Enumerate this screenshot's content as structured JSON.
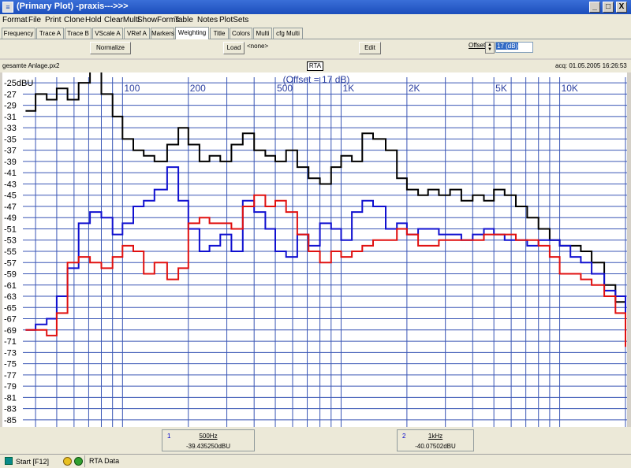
{
  "window": {
    "title": "(Primary Plot) -praxis--->>>",
    "minimize": "_",
    "maximize": "□",
    "close": "X"
  },
  "menu": [
    "Format",
    "File",
    "Print",
    "Clone",
    "Hold",
    "ClearMulti",
    "ShowForms",
    "Table",
    "Notes",
    "PlotSets"
  ],
  "tabs": [
    "Frequency",
    "Trace A",
    "Trace B",
    "VScale A",
    "VRef A",
    "Markers",
    "Weighting",
    "Title",
    "Colors",
    "Multi",
    "cfg Multi"
  ],
  "active_tab": "Weighting",
  "toolbar": {
    "normalize_label": "Normalize",
    "load_label": "Load",
    "none_label": "<none>",
    "edit_label": "Edit",
    "offset_label": "Offset",
    "offset_value": "17 (dB)"
  },
  "info": {
    "file": "gesamte Anlage.px2",
    "mode": "RTA",
    "acq": "acq: 01.05.2005 16:26:53"
  },
  "markers": [
    {
      "num": "1",
      "freq": "500Hz",
      "value": "-39.435250dBU"
    },
    {
      "num": "2",
      "freq": "1kHz",
      "value": "-40.07502dBU"
    }
  ],
  "status": {
    "start": "Start [F12]",
    "mode": "RTA Data"
  },
  "colors": {
    "grid": "#3a56b5",
    "trace_black": "#000000",
    "trace_blue": "#1010d0",
    "trace_red": "#e01010",
    "axis_text": "#2b3fa0"
  },
  "chart_data": {
    "type": "line",
    "title": "",
    "annotation": "(Offset = 17 dB)",
    "xscale": "log",
    "xlim": [
      35,
      20000
    ],
    "ylim": [
      -86,
      -24
    ],
    "x_tick_labels": [
      {
        "f": 100,
        "label": "100"
      },
      {
        "f": 200,
        "label": "200"
      },
      {
        "f": 500,
        "label": "500"
      },
      {
        "f": 1000,
        "label": "1K"
      },
      {
        "f": 2000,
        "label": "2K"
      },
      {
        "f": 5000,
        "label": "5K"
      },
      {
        "f": 10000,
        "label": "10K"
      }
    ],
    "y_tick_labels": [
      "-25dBU",
      "-27",
      "-29",
      "-31",
      "-33",
      "-35",
      "-37",
      "-39",
      "-41",
      "-43",
      "-45",
      "-47",
      "-49",
      "-51",
      "-53",
      "-55",
      "-57",
      "-59",
      "-61",
      "-63",
      "-65",
      "-67",
      "-69",
      "-71",
      "-73",
      "-75",
      "-77",
      "-79",
      "-81",
      "-83",
      "-85"
    ],
    "series": [
      {
        "color": "#000000",
        "x": [
          36,
          40,
          45,
          50,
          56,
          63,
          71,
          80,
          90,
          100,
          112,
          125,
          140,
          160,
          180,
          200,
          225,
          250,
          280,
          315,
          355,
          400,
          450,
          500,
          560,
          630,
          710,
          800,
          900,
          1000,
          1120,
          1250,
          1400,
          1600,
          1800,
          2000,
          2250,
          2500,
          2800,
          3150,
          3550,
          4000,
          4500,
          5000,
          5600,
          6300,
          7100,
          8000,
          9000,
          10000,
          11200,
          12500,
          14000,
          16000,
          18000,
          20000
        ],
        "y": [
          -30,
          -27,
          -28,
          -26,
          -28,
          -25,
          -23,
          -27,
          -31,
          -35,
          -37,
          -38,
          -39,
          -36,
          -33,
          -36,
          -39,
          -38,
          -39,
          -36,
          -34,
          -37,
          -38,
          -39,
          -37,
          -40,
          -42,
          -43,
          -40,
          -38,
          -39,
          -34,
          -35,
          -37,
          -42,
          -44,
          -45,
          -44,
          -45,
          -44,
          -46,
          -45,
          -46,
          -44,
          -45,
          -47,
          -49,
          -51,
          -53,
          -54,
          -54,
          -55,
          -57,
          -61,
          -64,
          -66
        ]
      },
      {
        "color": "#1010d0",
        "x": [
          36,
          40,
          45,
          50,
          56,
          63,
          71,
          80,
          90,
          100,
          112,
          125,
          140,
          160,
          180,
          200,
          225,
          250,
          280,
          315,
          355,
          400,
          450,
          500,
          560,
          630,
          710,
          800,
          900,
          1000,
          1120,
          1250,
          1400,
          1600,
          1800,
          2000,
          2250,
          2500,
          2800,
          3150,
          3550,
          4000,
          4500,
          5000,
          5600,
          6300,
          7100,
          8000,
          9000,
          10000,
          11200,
          12500,
          14000,
          16000,
          18000,
          20000
        ],
        "y": [
          -69,
          -68,
          -67,
          -63,
          -58,
          -50,
          -48,
          -49,
          -52,
          -50,
          -47,
          -46,
          -44,
          -40,
          -46,
          -51,
          -55,
          -54,
          -52,
          -55,
          -46,
          -48,
          -51,
          -55,
          -56,
          -52,
          -54,
          -50,
          -51,
          -53,
          -48,
          -46,
          -47,
          -51,
          -50,
          -52,
          -51,
          -51,
          -52,
          -52,
          -53,
          -52,
          -51,
          -52,
          -53,
          -53,
          -54,
          -53,
          -53,
          -54,
          -56,
          -57,
          -59,
          -62,
          -63,
          -66
        ]
      },
      {
        "color": "#e01010",
        "x": [
          36,
          40,
          45,
          50,
          56,
          63,
          71,
          80,
          90,
          100,
          112,
          125,
          140,
          160,
          180,
          200,
          225,
          250,
          280,
          315,
          355,
          400,
          450,
          500,
          560,
          630,
          710,
          800,
          900,
          1000,
          1120,
          1250,
          1400,
          1600,
          1800,
          2000,
          2250,
          2500,
          2800,
          3150,
          3550,
          4000,
          4500,
          5000,
          5600,
          6300,
          7100,
          8000,
          9000,
          10000,
          11200,
          12500,
          14000,
          16000,
          18000,
          20000
        ],
        "y": [
          -69,
          -69,
          -70,
          -66,
          -57,
          -56,
          -57,
          -58,
          -56,
          -54,
          -55,
          -59,
          -57,
          -60,
          -58,
          -50,
          -49,
          -50,
          -50,
          -51,
          -47,
          -45,
          -47,
          -46,
          -48,
          -52,
          -55,
          -57,
          -55,
          -56,
          -55,
          -54,
          -53,
          -53,
          -51,
          -52,
          -54,
          -54,
          -53,
          -53,
          -53,
          -53,
          -52,
          -52,
          -52,
          -53,
          -53,
          -54,
          -56,
          -59,
          -59,
          -60,
          -61,
          -63,
          -66,
          -72
        ]
      }
    ]
  }
}
